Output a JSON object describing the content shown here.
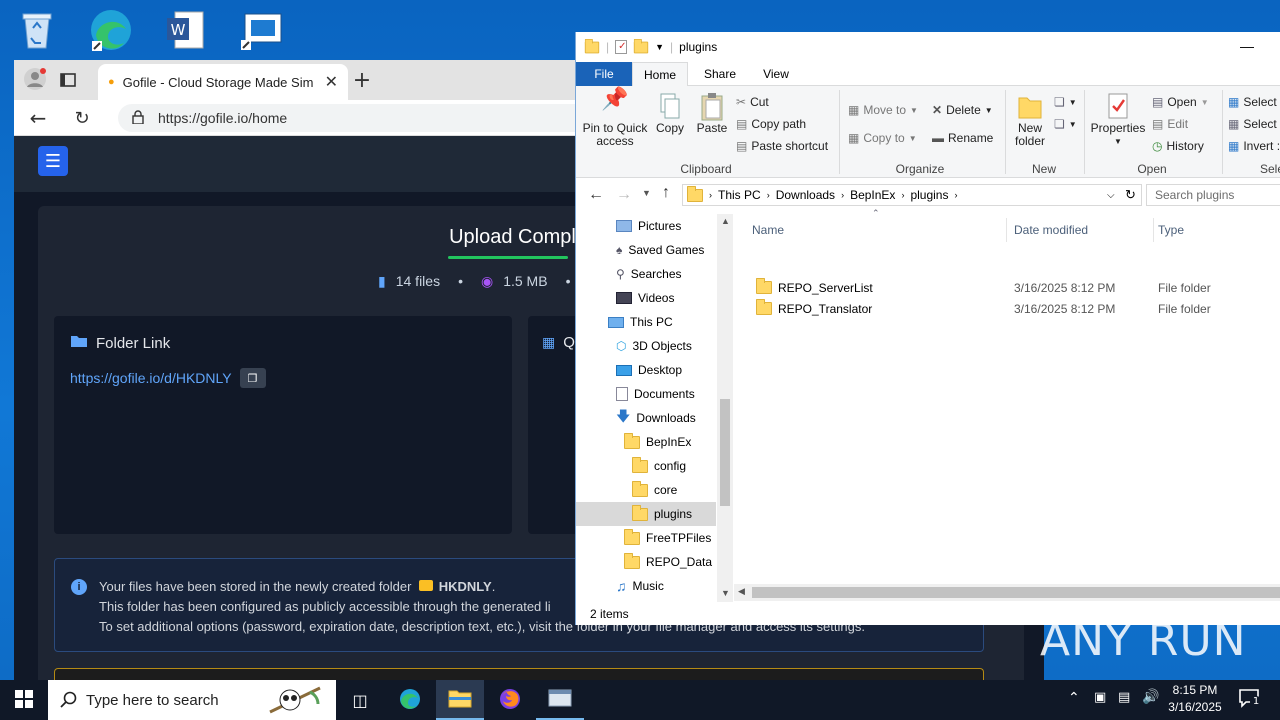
{
  "browser": {
    "tab_title": "Gofile - Cloud Storage Made Sim",
    "url": "https://gofile.io/home",
    "page": {
      "upload_title": "Upload Comple",
      "file_count": "14 files",
      "size": "1.5 MB",
      "bullet": "•",
      "folder_link_title": "Folder Link",
      "folder_link_url": "https://gofile.io/d/HKDNLY",
      "second_card_title_fragment": "Q",
      "info_line1_prefix": "Your files have been stored in the newly created folder",
      "info_folder_name": "HKDNLY",
      "info_line1_suffix": ".",
      "info_line2": "This folder has been configured as publicly accessible through the generated li",
      "info_line3": "To set additional options (password, expiration date, description text, etc.), visit the folder in your file manager and access its settings."
    }
  },
  "explorer": {
    "title": "plugins",
    "tabs": [
      "File",
      "Home",
      "Share",
      "View"
    ],
    "active_tab": "Home",
    "ribbon": {
      "pin": "Pin to Quick access",
      "copy": "Copy",
      "paste": "Paste",
      "cut": "Cut",
      "copy_path": "Copy path",
      "paste_shortcut": "Paste shortcut",
      "move_to": "Move to",
      "copy_to": "Copy to",
      "delete": "Delete",
      "rename": "Rename",
      "new_folder": "New folder",
      "properties": "Properties",
      "open": "Open",
      "edit": "Edit",
      "history": "History",
      "select1": "Select",
      "select2": "Select",
      "invert": "Invert :",
      "groups": [
        "Clipboard",
        "Organize",
        "New",
        "Open",
        "Sele"
      ]
    },
    "breadcrumb": [
      "This PC",
      "Downloads",
      "BepInEx",
      "plugins"
    ],
    "search_placeholder": "Search plugins",
    "nav": [
      {
        "label": "Pictures",
        "icon": "pictures-icon"
      },
      {
        "label": "Saved Games",
        "icon": "saved-games-icon"
      },
      {
        "label": "Searches",
        "icon": "searches-icon"
      },
      {
        "label": "Videos",
        "icon": "videos-icon"
      },
      {
        "label": "This PC",
        "icon": "this-pc-icon"
      },
      {
        "label": "3D Objects",
        "icon": "3d-objects-icon"
      },
      {
        "label": "Desktop",
        "icon": "desktop-icon"
      },
      {
        "label": "Documents",
        "icon": "documents-icon"
      },
      {
        "label": "Downloads",
        "icon": "downloads-icon"
      },
      {
        "label": "BepInEx",
        "icon": "folder-icon"
      },
      {
        "label": "config",
        "icon": "folder-icon"
      },
      {
        "label": "core",
        "icon": "folder-icon"
      },
      {
        "label": "plugins",
        "icon": "folder-icon"
      },
      {
        "label": "FreeTPFiles",
        "icon": "folder-icon"
      },
      {
        "label": "REPO_Data",
        "icon": "folder-icon"
      },
      {
        "label": "Music",
        "icon": "music-icon"
      }
    ],
    "columns": [
      "Name",
      "Date modified",
      "Type"
    ],
    "files": [
      {
        "name": "REPO_ServerList",
        "date": "3/16/2025 8:12 PM",
        "type": "File folder"
      },
      {
        "name": "REPO_Translator",
        "date": "3/16/2025 8:12 PM",
        "type": "File folder"
      }
    ],
    "status": "2 items"
  },
  "taskbar": {
    "search_placeholder": "Type here to search",
    "time": "8:15 PM",
    "date": "3/16/2025",
    "notification_count": "1"
  },
  "watermark": "ANY RUN",
  "colors": {
    "desktop_blue": "#0b6fc8",
    "gofile_accent": "#2563eb",
    "success_green": "#22c55e",
    "link_blue": "#60a5fa",
    "explorer_file_tab": "#1a63b8"
  }
}
